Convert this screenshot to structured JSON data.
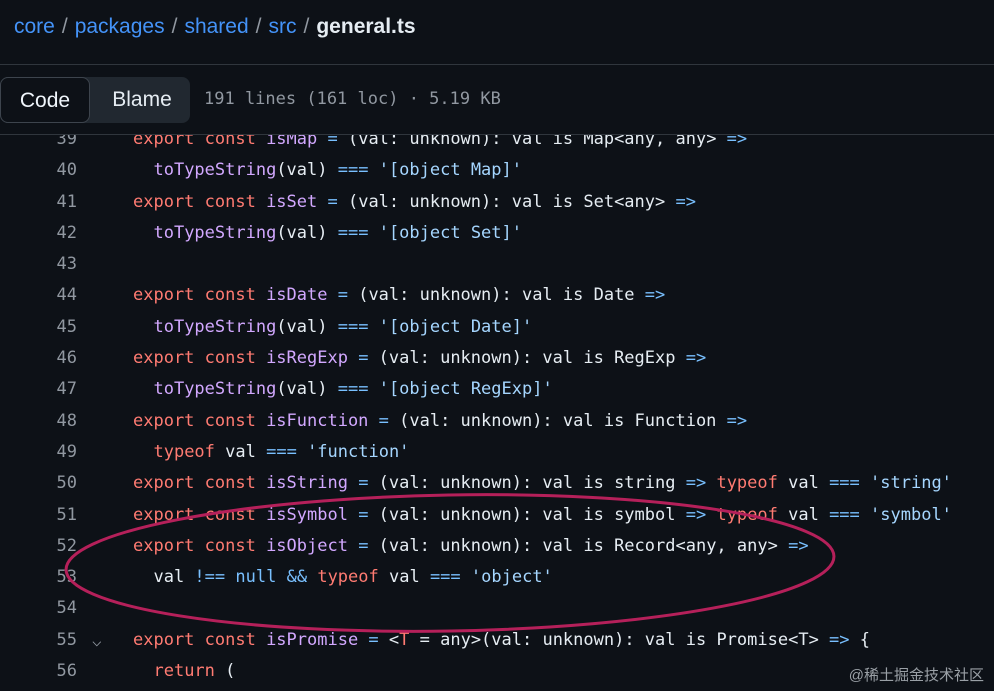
{
  "breadcrumb": {
    "parts": [
      "core",
      "packages",
      "shared",
      "src"
    ],
    "separator": "/",
    "current": "general.ts"
  },
  "toolbar": {
    "code_label": "Code",
    "blame_label": "Blame",
    "file_meta": "191 lines (161 loc) · 5.19 KB"
  },
  "code_lines": [
    {
      "num": "39",
      "tokens": [
        [
          "kw",
          "export const "
        ],
        [
          "fn",
          "isMap"
        ],
        [
          "op",
          " = "
        ],
        [
          "typ",
          "(val: unknown): val is Map<any, any> "
        ],
        [
          "op",
          "=>"
        ]
      ]
    },
    {
      "num": "40",
      "tokens": [
        [
          "typ",
          "  "
        ],
        [
          "fn",
          "toTypeString"
        ],
        [
          "typ",
          "(val) "
        ],
        [
          "op",
          "==="
        ],
        [
          "typ",
          " "
        ],
        [
          "str",
          "'[object Map]'"
        ]
      ]
    },
    {
      "num": "41",
      "tokens": [
        [
          "kw",
          "export const "
        ],
        [
          "fn",
          "isSet"
        ],
        [
          "op",
          " = "
        ],
        [
          "typ",
          "(val: unknown): val is Set<any> "
        ],
        [
          "op",
          "=>"
        ]
      ]
    },
    {
      "num": "42",
      "tokens": [
        [
          "typ",
          "  "
        ],
        [
          "fn",
          "toTypeString"
        ],
        [
          "typ",
          "(val) "
        ],
        [
          "op",
          "==="
        ],
        [
          "typ",
          " "
        ],
        [
          "str",
          "'[object Set]'"
        ]
      ]
    },
    {
      "num": "43",
      "tokens": []
    },
    {
      "num": "44",
      "tokens": [
        [
          "kw",
          "export const "
        ],
        [
          "fn",
          "isDate"
        ],
        [
          "op",
          " = "
        ],
        [
          "typ",
          "(val: unknown): val is Date "
        ],
        [
          "op",
          "=>"
        ]
      ]
    },
    {
      "num": "45",
      "tokens": [
        [
          "typ",
          "  "
        ],
        [
          "fn",
          "toTypeString"
        ],
        [
          "typ",
          "(val) "
        ],
        [
          "op",
          "==="
        ],
        [
          "typ",
          " "
        ],
        [
          "str",
          "'[object Date]'"
        ]
      ]
    },
    {
      "num": "46",
      "tokens": [
        [
          "kw",
          "export const "
        ],
        [
          "fn",
          "isRegExp"
        ],
        [
          "op",
          " = "
        ],
        [
          "typ",
          "(val: unknown): val is RegExp "
        ],
        [
          "op",
          "=>"
        ]
      ]
    },
    {
      "num": "47",
      "tokens": [
        [
          "typ",
          "  "
        ],
        [
          "fn",
          "toTypeString"
        ],
        [
          "typ",
          "(val) "
        ],
        [
          "op",
          "==="
        ],
        [
          "typ",
          " "
        ],
        [
          "str",
          "'[object RegExp]'"
        ]
      ]
    },
    {
      "num": "48",
      "tokens": [
        [
          "kw",
          "export const "
        ],
        [
          "fn",
          "isFunction"
        ],
        [
          "op",
          " = "
        ],
        [
          "typ",
          "(val: unknown): val is Function "
        ],
        [
          "op",
          "=>"
        ]
      ]
    },
    {
      "num": "49",
      "tokens": [
        [
          "typ",
          "  "
        ],
        [
          "kw",
          "typeof"
        ],
        [
          "typ",
          " val "
        ],
        [
          "op",
          "==="
        ],
        [
          "typ",
          " "
        ],
        [
          "str",
          "'function'"
        ]
      ]
    },
    {
      "num": "50",
      "tokens": [
        [
          "kw",
          "export const "
        ],
        [
          "fn",
          "isString"
        ],
        [
          "op",
          " = "
        ],
        [
          "typ",
          "(val: unknown): val is string "
        ],
        [
          "op",
          "=>"
        ],
        [
          "typ",
          " "
        ],
        [
          "kw",
          "typeof"
        ],
        [
          "typ",
          " val "
        ],
        [
          "op",
          "==="
        ],
        [
          "typ",
          " "
        ],
        [
          "str",
          "'string'"
        ]
      ]
    },
    {
      "num": "51",
      "tokens": [
        [
          "kw",
          "export const "
        ],
        [
          "fn",
          "isSymbol"
        ],
        [
          "op",
          " = "
        ],
        [
          "typ",
          "(val: unknown): val is symbol "
        ],
        [
          "op",
          "=>"
        ],
        [
          "typ",
          " "
        ],
        [
          "kw",
          "typeof"
        ],
        [
          "typ",
          " val "
        ],
        [
          "op",
          "==="
        ],
        [
          "typ",
          " "
        ],
        [
          "str",
          "'symbol'"
        ]
      ]
    },
    {
      "num": "52",
      "tokens": [
        [
          "kw",
          "export const "
        ],
        [
          "fn",
          "isObject"
        ],
        [
          "op",
          " = "
        ],
        [
          "typ",
          "(val: unknown): val is Record<any, any> "
        ],
        [
          "op",
          "=>"
        ]
      ]
    },
    {
      "num": "53",
      "tokens": [
        [
          "typ",
          "  val "
        ],
        [
          "op",
          "!=="
        ],
        [
          "typ",
          " "
        ],
        [
          "op",
          "null"
        ],
        [
          "typ",
          " "
        ],
        [
          "op",
          "&&"
        ],
        [
          "typ",
          " "
        ],
        [
          "kw",
          "typeof"
        ],
        [
          "typ",
          " val "
        ],
        [
          "op",
          "==="
        ],
        [
          "typ",
          " "
        ],
        [
          "str",
          "'object'"
        ]
      ]
    },
    {
      "num": "54",
      "tokens": []
    },
    {
      "num": "55",
      "fold": true,
      "tokens": [
        [
          "kw",
          "export const "
        ],
        [
          "fn",
          "isPromise"
        ],
        [
          "op",
          " = "
        ],
        [
          "typ",
          "<"
        ],
        [
          "kw",
          "T"
        ],
        [
          "typ",
          " = any>(val: unknown): val is Promise<T> "
        ],
        [
          "op",
          "=>"
        ],
        [
          "typ",
          " {"
        ]
      ]
    },
    {
      "num": "56",
      "tokens": [
        [
          "typ",
          "  "
        ],
        [
          "kw",
          "return"
        ],
        [
          "typ",
          " ("
        ]
      ]
    }
  ],
  "colors": {
    "background": "#0d1117",
    "keyword": "#ff7b72",
    "function": "#d2a8ff",
    "string": "#a5d6ff",
    "operator": "#79c0ff",
    "annotation": "#b5205a"
  },
  "watermark": "@稀土掘金技术社区"
}
